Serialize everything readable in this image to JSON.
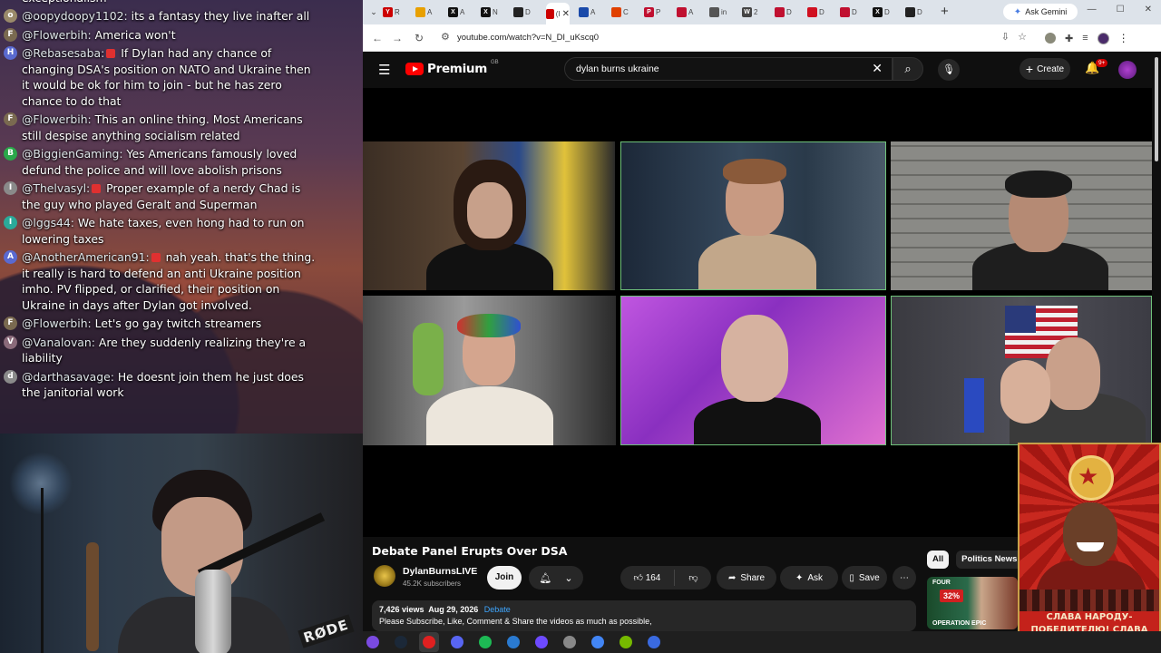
{
  "chat": {
    "partial_top": "exceptionalism",
    "messages": [
      {
        "user": "@oopydoopy1102:",
        "text": " its a fantasy they live inafter all",
        "color": "#9a8a6a",
        "initial": "o"
      },
      {
        "user": "@Flowerbih:",
        "text": " America won't",
        "color": "#7a6a50",
        "initial": "F"
      },
      {
        "user": "@Rebasesaba:",
        "text": " If Dylan had any chance of changing DSA's position on NATO and Ukraine then it would be ok for him to join - but he has zero chance to do that",
        "color": "#5a6ad0",
        "initial": "H",
        "badge": true
      },
      {
        "user": "@Flowerbih:",
        "text": " This an online thing. Most Americans still despise anything socialism related",
        "color": "#7a6a50",
        "initial": "F"
      },
      {
        "user": "@BiggienGaming:",
        "text": " Yes Americans famously loved defund the police and will love abolish prisons",
        "color": "#2aa84a",
        "initial": "B"
      },
      {
        "user": "@Thelvasyl:",
        "text": " Proper example of a nerdy Chad is the guy who played Geralt and Superman",
        "color": "#8a8a8a",
        "initial": "I",
        "badge": true
      },
      {
        "user": "@lggs44:",
        "text": " We hate taxes, even hong had to run on lowering taxes",
        "color": "#2aaa9a",
        "initial": "I"
      },
      {
        "user": "@AnotherAmerican91:",
        "text": " nah yeah. that's the thing. it really is hard to defend an anti Ukraine position imho. PV flipped, or clarified, their position on Ukraine in days after Dylan got involved.",
        "color": "#5a6ad0",
        "initial": "A",
        "badge": true
      },
      {
        "user": "@Flowerbih:",
        "text": " Let's go gay twitch streamers",
        "color": "#7a6a50",
        "initial": "F"
      },
      {
        "user": "@Vanalovan:",
        "text": " Are they suddenly realizing they're a liability",
        "color": "#8a6a7a",
        "initial": "V"
      },
      {
        "user": "@darthasavage:",
        "text": " He doesnt join them he just does the janitorial work",
        "color": "#8a8a8a",
        "initial": "d"
      }
    ]
  },
  "webcam": {
    "mic_brand": "RØDE"
  },
  "browser": {
    "tabs": [
      {
        "letter": "Y",
        "label": "R",
        "color": "#cc0000"
      },
      {
        "letter": "",
        "label": "A",
        "color": "#e8a000"
      },
      {
        "letter": "X",
        "label": "A",
        "color": "#111111"
      },
      {
        "letter": "X",
        "label": "N",
        "color": "#111111"
      },
      {
        "letter": "",
        "label": "D",
        "color": "#222222"
      },
      {
        "letter": "",
        "label": "(I",
        "color": "#cc0000",
        "active": true
      },
      {
        "letter": "",
        "label": "A",
        "color": "#1a4aaa"
      },
      {
        "letter": "",
        "label": "C",
        "color": "#e04000"
      },
      {
        "letter": "P",
        "label": "P",
        "color": "#c01030"
      },
      {
        "letter": "",
        "label": "A",
        "color": "#c01030"
      },
      {
        "letter": "",
        "label": "in",
        "color": "#555555"
      },
      {
        "letter": "W",
        "label": "2",
        "color": "#444444"
      },
      {
        "letter": "",
        "label": "D",
        "color": "#c01030"
      },
      {
        "letter": "",
        "label": "D",
        "color": "#d01020"
      },
      {
        "letter": "",
        "label": "D",
        "color": "#c01030"
      },
      {
        "letter": "X",
        "label": "D",
        "color": "#111111"
      },
      {
        "letter": "",
        "label": "D",
        "color": "#222222"
      }
    ],
    "new_tab": "+",
    "gemini_label": "Ask Gemini",
    "url": "youtube.com/watch?v=N_DI_uKscq0",
    "window_controls": [
      "—",
      "☐",
      "✕"
    ]
  },
  "youtube": {
    "logo_text": "Premium",
    "logo_region": "GB",
    "search_query": "dylan burns ukraine",
    "create_label": "Create",
    "notif_count": "9+",
    "video": {
      "title": "Debate Panel Erupts Over DSA",
      "channel": "DylanBurnsLIVE",
      "subscribers": "45.2K subscribers",
      "join": "Join",
      "likes": "164",
      "share": "Share",
      "ask": "Ask",
      "save": "Save",
      "views": "7,426 views",
      "date": "Aug 29, 2026",
      "tag": "Debate",
      "description": "Please Subscribe, Like, Comment & Share the videos as much as possible,"
    },
    "chips": [
      "All",
      "Politics News"
    ],
    "rec_thumb": {
      "top": "FOUR",
      "pct": "32%",
      "bottom": "OPERATION EPIC"
    }
  },
  "poster": {
    "text": "СЛАВА НАРОДУ-ПОБЕДИТЕЛЮ! СЛАВА РОДНОМУ СТАЛИНУ!"
  },
  "colors": {
    "accent_red": "#ff0000",
    "link_blue": "#3ea6ff",
    "active_speaker": "#6fc27a"
  },
  "taskbar": {
    "icons": [
      "arc-icon",
      "steam-icon",
      "obs-icon",
      "discord-icon",
      "spotify-icon",
      "app-icon",
      "proton-icon",
      "settings-icon",
      "chrome-icon",
      "nvidia-icon",
      "streamer-icon"
    ]
  }
}
